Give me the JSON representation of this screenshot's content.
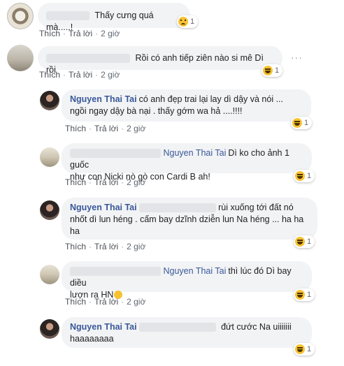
{
  "actions": {
    "like": "Thích",
    "reply": "Trả lời",
    "sep": "·",
    "time": "2 giờ"
  },
  "more_icon": "···",
  "comments": [
    {
      "text": "Thấy cưng quá mà.....!",
      "reaction": "sad-icon",
      "count": "1"
    },
    {
      "text": "Rồi có anh tiếp ziên nào si mê Dì rồi",
      "reaction": "haha-icon",
      "count": "1"
    }
  ],
  "replies": [
    {
      "name": "Nguyen Thai Tai",
      "line1": "có anh đẹp trai lại lay dì dậy và nói ...",
      "line2": "ngồi ngay dậy bà nại . thấy gớm wa hả ....!!!!",
      "count": "1"
    },
    {
      "name": "Nguyen Thai Tai",
      "line1": "Dì ko cho ảnh 1 guốc",
      "line2": "như con Nicki nò gò con Cardi B ah!",
      "count": "1"
    },
    {
      "name": "Nguyen Thai Tai",
      "line1": "rùi xuống tới đất nó",
      "line2": "nhốt dì lun héng . cấm bay dzĩnh dziễn lun Na héng ... ha ha",
      "line3": "ha",
      "count": "1"
    },
    {
      "name": "Nguyen Thai Tai",
      "line1": "thì lúc đó Dì bay diều",
      "line2": "lượn ra HN",
      "count": "1"
    },
    {
      "name": "Nguyen Thai Tai",
      "line1": "đứt cước Na uiiiiiii",
      "line2": "haaaaaaaa",
      "count": "1"
    }
  ]
}
